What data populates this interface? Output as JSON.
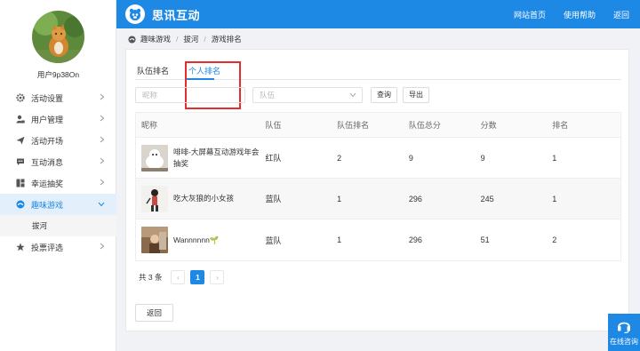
{
  "header": {
    "brand": "思讯互动",
    "nav": [
      "网站首页",
      "使用帮助",
      "返回"
    ]
  },
  "sidebar": {
    "username": "用户9p38On",
    "items": [
      {
        "label": "活动设置",
        "icon": "gear-icon"
      },
      {
        "label": "用户管理",
        "icon": "user-lock-icon"
      },
      {
        "label": "活动开场",
        "icon": "paper-plane-icon"
      },
      {
        "label": "互动消息",
        "icon": "chat-bubble-icon"
      },
      {
        "label": "幸运抽奖",
        "icon": "grid-icon"
      },
      {
        "label": "趣味游戏",
        "icon": "gamepad-icon"
      },
      {
        "label": "投票评选",
        "icon": "star-icon"
      }
    ],
    "active_index": 5,
    "submenu": "拔河"
  },
  "breadcrumb": [
    "趣味游戏",
    "拔河",
    "游戏排名"
  ],
  "tabs": [
    "队伍排名",
    "个人排名"
  ],
  "active_tab": 1,
  "filters": {
    "name_placeholder": "昵称",
    "team_placeholder": "队伍",
    "search_label": "查询",
    "export_label": "导出"
  },
  "table": {
    "headers": [
      "昵称",
      "队伍",
      "队伍排名",
      "队伍总分",
      "分数",
      "排名"
    ],
    "rows": [
      {
        "nickname": "啡啡-大屏幕互动游戏年会抽奖",
        "team": "红队",
        "team_rank": "2",
        "team_score": "9",
        "score": "9",
        "rank": "1"
      },
      {
        "nickname": "吃大灰狼的小女孩",
        "team": "蓝队",
        "team_rank": "1",
        "team_score": "296",
        "score": "245",
        "rank": "1"
      },
      {
        "nickname": "Wannnnnn🌱",
        "team": "蓝队",
        "team_rank": "1",
        "team_score": "296",
        "score": "51",
        "rank": "2"
      }
    ]
  },
  "pagination": {
    "total_label": "共 3 条",
    "current_page": "1",
    "prev": "‹",
    "next": "›"
  },
  "back_label": "返回",
  "help_label": "在线咨询",
  "colors": {
    "primary": "#1e88e5",
    "highlight_border": "#e52d2d"
  }
}
